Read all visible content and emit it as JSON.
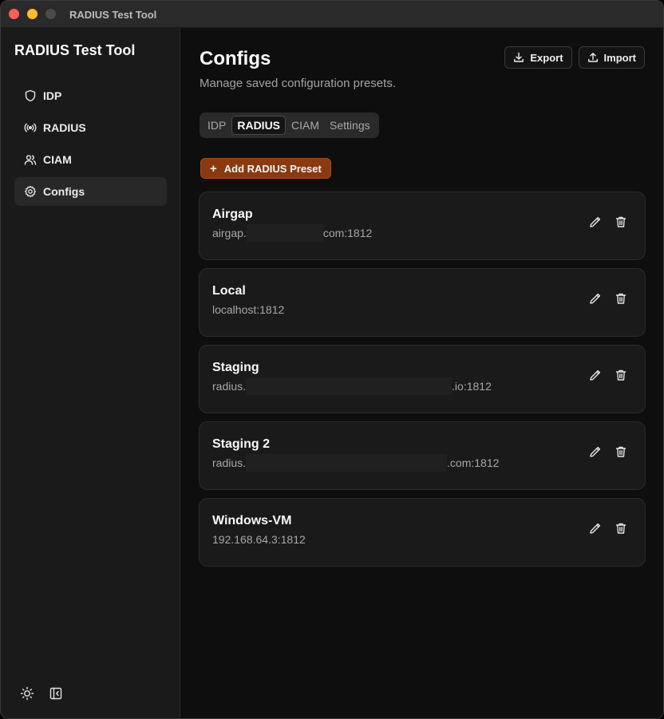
{
  "window": {
    "title": "RADIUS Test Tool"
  },
  "sidebar": {
    "app_title": "RADIUS Test Tool",
    "items": [
      {
        "label": "IDP",
        "icon": "shield-icon"
      },
      {
        "label": "RADIUS",
        "icon": "radio-signal-icon"
      },
      {
        "label": "CIAM",
        "icon": "users-icon"
      },
      {
        "label": "Configs",
        "icon": "gear-icon",
        "active": true
      }
    ],
    "footer": {
      "theme_icon": "sun-icon",
      "collapse_icon": "sidebar-collapse-icon"
    }
  },
  "main": {
    "title": "Configs",
    "subtitle": "Manage saved configuration presets.",
    "export_label": "Export",
    "import_label": "Import",
    "tabs": [
      {
        "label": "IDP"
      },
      {
        "label": "RADIUS",
        "active": true
      },
      {
        "label": "CIAM"
      },
      {
        "label": "Settings"
      }
    ],
    "add_label": "Add RADIUS Preset",
    "presets": [
      {
        "name": "Airgap",
        "host_prefix": "airgap.",
        "host_suffix": "com:1812",
        "redacted": true
      },
      {
        "name": "Local",
        "host_prefix": "localhost:1812",
        "host_suffix": "",
        "redacted": false
      },
      {
        "name": "Staging",
        "host_prefix": "radius.",
        "host_suffix": ".io:1812",
        "redacted": true
      },
      {
        "name": "Staging 2",
        "host_prefix": "radius.",
        "host_suffix": ".com:1812",
        "redacted": true
      },
      {
        "name": "Windows-VM",
        "host_prefix": "192.168.64.3:1812",
        "host_suffix": "",
        "redacted": false
      }
    ]
  },
  "colors": {
    "accent": "#8a3a10",
    "background": "#0e0e0e",
    "sidebar": "#1a1a1a",
    "card": "#1a1a1a"
  }
}
